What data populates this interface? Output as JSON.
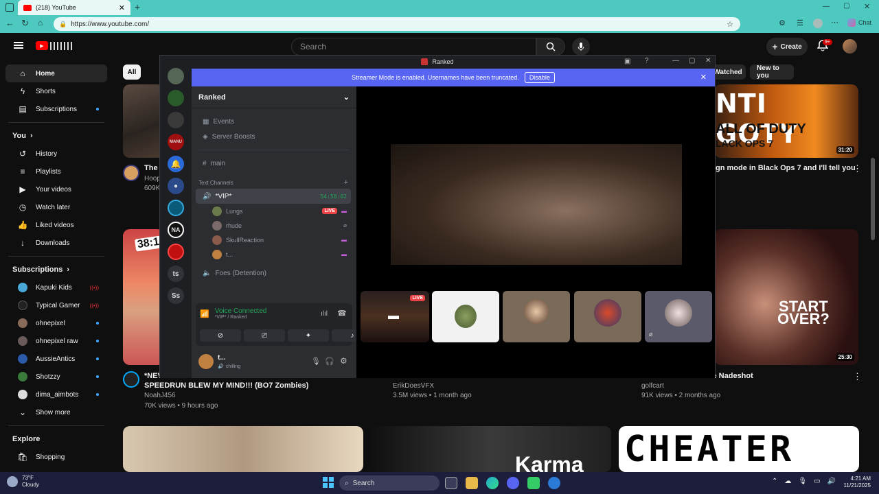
{
  "browser": {
    "tab_title": "(218) YouTube",
    "url": "https://www.youtube.com/",
    "chat_label": "Chat"
  },
  "youtube": {
    "search_placeholder": "Search",
    "create_label": "Create",
    "notification_count": "9+",
    "chips": [
      "All",
      "Watched",
      "New to you"
    ],
    "sidebar": {
      "main": [
        {
          "label": "Home",
          "icon": "home-icon",
          "active": true
        },
        {
          "label": "Shorts",
          "icon": "shorts-icon"
        },
        {
          "label": "Subscriptions",
          "icon": "subscriptions-icon",
          "dot": true
        }
      ],
      "you_header": "You",
      "you": [
        {
          "label": "History",
          "icon": "history-icon"
        },
        {
          "label": "Playlists",
          "icon": "playlists-icon"
        },
        {
          "label": "Your videos",
          "icon": "your-videos-icon"
        },
        {
          "label": "Watch later",
          "icon": "watch-later-icon"
        },
        {
          "label": "Liked videos",
          "icon": "liked-icon"
        },
        {
          "label": "Downloads",
          "icon": "downloads-icon"
        }
      ],
      "subs_header": "Subscriptions",
      "subs": [
        {
          "label": "Kapuki Kids",
          "status": "live",
          "color": "#4aa8d8"
        },
        {
          "label": "Typical Gamer",
          "status": "live",
          "color": "#222222"
        },
        {
          "label": "ohnepixel",
          "status": "dot",
          "color": "#8a6a5a"
        },
        {
          "label": "ohnepixel raw",
          "status": "dot",
          "color": "#6a5a5a"
        },
        {
          "label": "AussieAntics",
          "status": "dot",
          "color": "#2a5aa8"
        },
        {
          "label": "Shotzzy",
          "status": "dot",
          "color": "#3a7a3a"
        },
        {
          "label": "dima_aimbots",
          "status": "dot",
          "color": "#dddddd"
        }
      ],
      "show_more": "Show more",
      "explore_header": "Explore",
      "explore_first": "Shopping"
    },
    "videos": {
      "row1_left_title": "The",
      "row1_left_channel": "Hoop",
      "row1_left_views": "609K",
      "row1_right_title": "gn mode in Black Ops 7 and I'll tell you",
      "row1_right_duration": "31:20",
      "row1_right_thumb_text": "NTI GOTY",
      "row1_right_thumb_sub": "ALL OF DUTY",
      "row1_right_thumb_sub2": "LACK OPS 7",
      "row2_left_title_1": "*NEV",
      "row2_left_title_2": "SPEEDRUN BLEW MY MIND!!! (BO7 Zombies)",
      "row2_left_channel": "NoahJ456",
      "row2_left_meta": "70K views • 9 hours ago",
      "row2_left_badge": "38:1",
      "row2_mid_channel": "ErikDoesVFX",
      "row2_mid_meta": "3.5M views • 1 month ago",
      "row2_right_title": "le That Almost Broke Nadeshot",
      "row2_right_channel": "golfcart",
      "row2_right_meta": "91K views • 2 months ago",
      "row2_right_duration": "25:30",
      "row2_right_thumb_text_1": "START",
      "row2_right_thumb_text_2": "OVER?",
      "row3_mid_text": "Karma",
      "row3_right_text": "CHEATER"
    }
  },
  "discord": {
    "window_title": "Ranked",
    "banner_text": "Streamer Mode is enabled. Usernames have been truncated.",
    "banner_button": "Disable",
    "server_name": "Ranked",
    "channels": [
      {
        "label": "Events",
        "icon": "calendar-icon"
      },
      {
        "label": "Server Boosts",
        "icon": "boost-icon"
      },
      {
        "label": "main",
        "icon": "hash-icon"
      }
    ],
    "category": "Text Channels",
    "voice_channel": "*VIP*",
    "voice_timer": "54:58:02",
    "voice_users": [
      {
        "label": "Lungs",
        "live": true,
        "color": "#6b7a4a"
      },
      {
        "label": "rhude",
        "live": false,
        "color": "#7a6a6a"
      },
      {
        "label": "SkullReaction",
        "live": false,
        "color": "#8a5a4a"
      },
      {
        "label": "t...",
        "live": false,
        "color": "#c08040"
      }
    ],
    "foes_channel": "Foes (Detention)",
    "guild_text": [
      "ts",
      "Ss"
    ],
    "guild_labels": [
      "MANU",
      "NA"
    ],
    "voice_connected": "Voice Connected",
    "voice_sub": "*VIP* / Ranked",
    "user_name": "t...",
    "user_status": "chilling",
    "live_label": "LIVE",
    "colors": {
      "blurple": "#5865f2",
      "green": "#23a55a",
      "live": "#ed4245"
    }
  },
  "taskbar": {
    "weather_temp": "73°F",
    "weather_desc": "Cloudy",
    "search_label": "Search",
    "time": "4:21 AM",
    "date": "11/21/2025"
  }
}
